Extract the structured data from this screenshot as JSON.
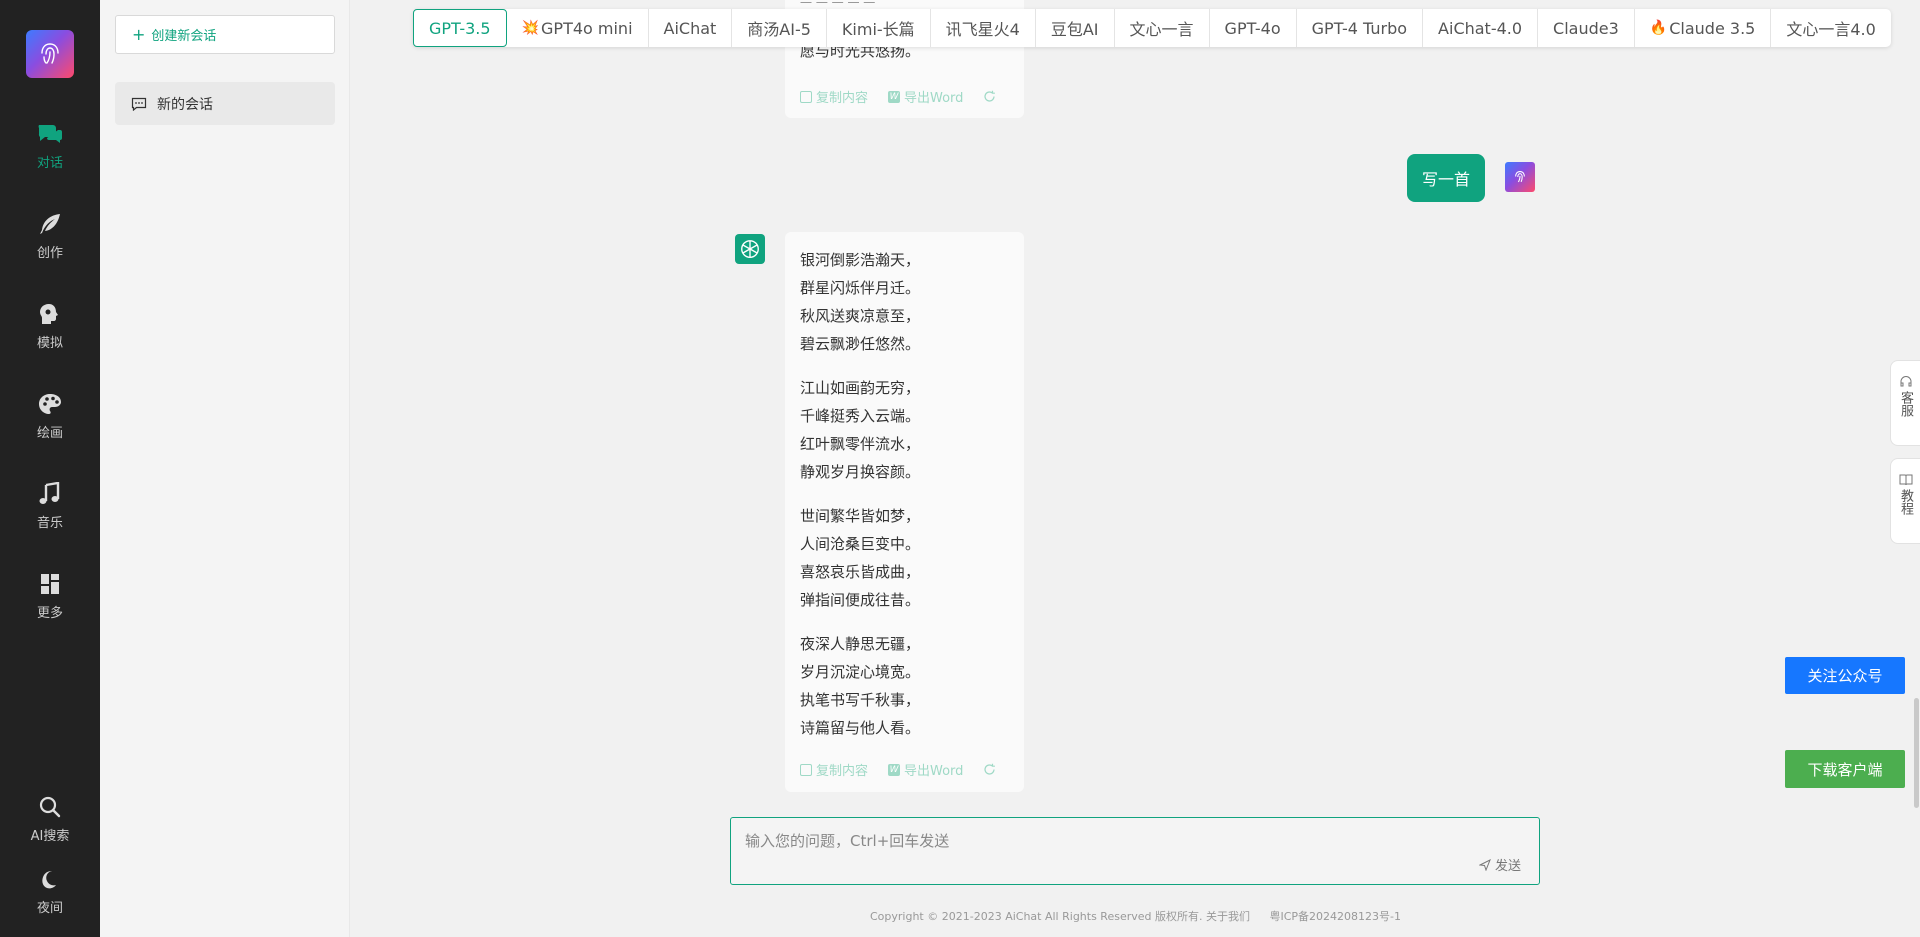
{
  "rail": {
    "items": [
      {
        "label": "对话",
        "icon": "chat-icon"
      },
      {
        "label": "创作",
        "icon": "feather-icon"
      },
      {
        "label": "模拟",
        "icon": "head-icon"
      },
      {
        "label": "绘画",
        "icon": "palette-icon"
      },
      {
        "label": "音乐",
        "icon": "music-icon"
      },
      {
        "label": "更多",
        "icon": "grid-icon"
      }
    ],
    "bottom": [
      {
        "label": "AI搜索",
        "icon": "search-icon"
      },
      {
        "label": "夜间",
        "icon": "moon-icon"
      }
    ]
  },
  "sidebar": {
    "new_chat": "创建新会话",
    "conversations": [
      {
        "title": "新的会话"
      }
    ]
  },
  "models": [
    {
      "label": "GPT-3.5",
      "prefix": ""
    },
    {
      "label": "GPT4o mini",
      "prefix": "💥"
    },
    {
      "label": "AiChat",
      "prefix": ""
    },
    {
      "label": "商汤AI-5",
      "prefix": ""
    },
    {
      "label": "Kimi-长篇",
      "prefix": ""
    },
    {
      "label": "讯飞星火4",
      "prefix": ""
    },
    {
      "label": "豆包AI",
      "prefix": ""
    },
    {
      "label": "文心一言",
      "prefix": ""
    },
    {
      "label": "GPT-4o",
      "prefix": ""
    },
    {
      "label": "GPT-4 Turbo",
      "prefix": ""
    },
    {
      "label": "AiChat-4.0",
      "prefix": ""
    },
    {
      "label": "Claude3",
      "prefix": ""
    },
    {
      "label": "Claude 3.5",
      "prefix": "🔥"
    },
    {
      "label": "文心一言4.0",
      "prefix": ""
    }
  ],
  "chat": {
    "prev_partial_top": "一 一 一 一 一",
    "prev_last_line": "愿与时光共悠扬。",
    "copy": "复制内容",
    "export": "导出Word",
    "user_message": "写一首",
    "poem": [
      [
        "银河倒影浩瀚天，",
        "群星闪烁伴月迁。",
        "秋风送爽凉意至，",
        "碧云飘渺任悠然。"
      ],
      [
        "江山如画韵无穷，",
        "千峰挺秀入云端。",
        "红叶飘零伴流水，",
        "静观岁月换容颜。"
      ],
      [
        "世间繁华皆如梦，",
        "人间沧桑巨变中。",
        "喜怒哀乐皆成曲，",
        "弹指间便成往昔。"
      ],
      [
        "夜深人静思无疆，",
        "岁月沉淀心境宽。",
        "执笔书写千秋事，",
        "诗篇留与他人看。"
      ]
    ]
  },
  "input": {
    "placeholder": "输入您的问题，Ctrl+回车发送",
    "send": "发送"
  },
  "footer": {
    "copyright": "Copyright © 2021-2023 AiChat All Rights Reserved 版权所有. 关于我们",
    "icp": "粤ICP备2024208123号-1"
  },
  "right": {
    "service": "客服",
    "tutorial": "教程",
    "follow": "关注公众号",
    "download": "下载客户端"
  },
  "colors": {
    "accent": "#10a37f",
    "rail_bg": "#222222",
    "follow_btn": "#1677ff",
    "download_btn": "#4cae4f"
  }
}
